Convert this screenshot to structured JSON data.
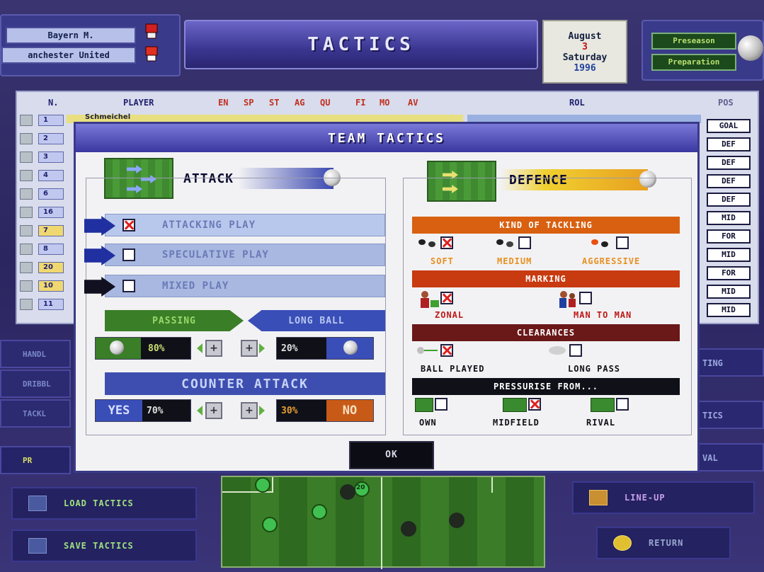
{
  "header": {
    "team_home": "Bayern M.",
    "team_away": "anchester United",
    "title": "TACTICS",
    "date": {
      "month": "August",
      "day": "3",
      "weekday": "Saturday",
      "year": "1996"
    },
    "prep_top": "Preseason",
    "prep_bottom": "Preparation"
  },
  "table": {
    "headers": {
      "n": "N.",
      "player": "PLAYER",
      "en": "EN",
      "sp": "SP",
      "st": "ST",
      "ag": "AG",
      "qu": "QU",
      "fi": "FI",
      "mo": "MO",
      "av": "AV",
      "rol": "ROL",
      "pos": "POS"
    },
    "first_player": "Schmeichel",
    "rows": [
      {
        "num": "1",
        "pos": "GOAL",
        "highlight": false
      },
      {
        "num": "2",
        "pos": "DEF",
        "highlight": false
      },
      {
        "num": "3",
        "pos": "DEF",
        "highlight": false
      },
      {
        "num": "4",
        "pos": "DEF",
        "highlight": false
      },
      {
        "num": "6",
        "pos": "DEF",
        "highlight": false
      },
      {
        "num": "16",
        "pos": "MID",
        "highlight": false
      },
      {
        "num": "7",
        "pos": "FOR",
        "highlight": true
      },
      {
        "num": "8",
        "pos": "MID",
        "highlight": false
      },
      {
        "num": "20",
        "pos": "FOR",
        "highlight": true
      },
      {
        "num": "10",
        "pos": "MID",
        "highlight": true
      },
      {
        "num": "11",
        "pos": "MID",
        "highlight": false
      }
    ]
  },
  "side_menu": [
    "HANDL",
    "DRIBBL",
    "TACKL",
    "PR"
  ],
  "right_menu": [
    "TING",
    "TICS",
    "VAL"
  ],
  "bottom": {
    "load_tactics": "LOAD TACTICS",
    "save_tactics": "SAVE TACTICS",
    "line_up": "LINE-UP",
    "return": "RETURN"
  },
  "modal": {
    "title": "TEAM TACTICS",
    "attack": {
      "heading": "ATTACK",
      "options": [
        {
          "label": "ATTACKING PLAY",
          "checked": true
        },
        {
          "label": "SPECULATIVE PLAY",
          "checked": false
        },
        {
          "label": "MIXED PLAY",
          "checked": false
        }
      ],
      "passing_label": "PASSING",
      "long_ball_label": "LONG BALL",
      "passing_value": "80%",
      "long_ball_value": "20%",
      "counter_heading": "COUNTER ATTACK",
      "yes_label": "YES",
      "no_label": "NO",
      "yes_value": "70%",
      "no_value": "30%"
    },
    "defence": {
      "heading": "DEFENCE",
      "tackling_heading": "KIND OF TACKLING",
      "tackling": [
        {
          "label": "SOFT",
          "checked": true
        },
        {
          "label": "MEDIUM",
          "checked": false
        },
        {
          "label": "AGGRESSIVE",
          "checked": false
        }
      ],
      "marking_heading": "MARKING",
      "marking": [
        {
          "label": "ZONAL",
          "checked": true
        },
        {
          "label": "MAN TO MAN",
          "checked": false
        }
      ],
      "clearances_heading": "CLEARANCES",
      "clearances": [
        {
          "label": "BALL PLAYED",
          "checked": true
        },
        {
          "label": "LONG PASS",
          "checked": false
        }
      ],
      "pressurise_heading": "PRESSURISE FROM...",
      "pressurise": [
        {
          "label": "OWN",
          "checked": false
        },
        {
          "label": "MIDFIELD",
          "checked": true
        },
        {
          "label": "RIVAL",
          "checked": false
        }
      ]
    },
    "ok_label": "OK"
  },
  "pitch": {
    "player_number": "20"
  },
  "colors": {
    "attack_option_bg": "#b8c8ec",
    "tackling_bar": "#d86010",
    "marking_bar": "#c83a10",
    "clearances_bar": "#6a1818",
    "pressurise_bar": "#101018"
  }
}
